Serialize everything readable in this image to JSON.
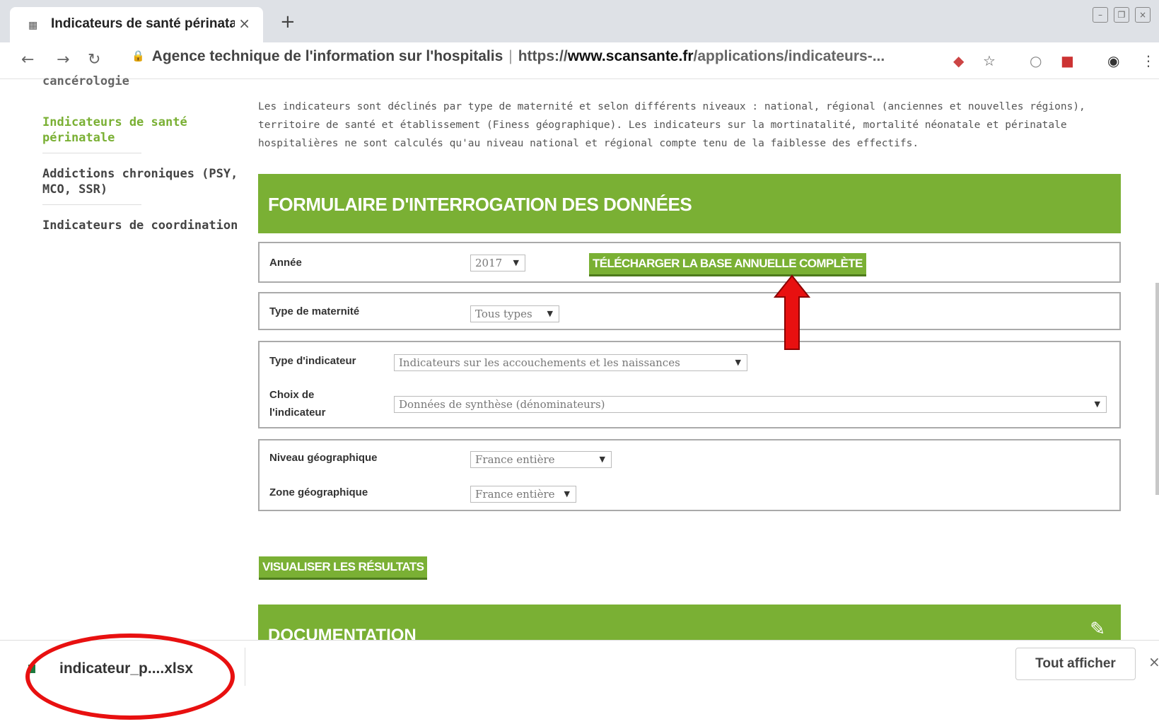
{
  "browser": {
    "tab_title": "Indicateurs de santé périnatale",
    "tab_close": "×",
    "new_tab": "+",
    "site_name": "Agence technique de l'information sur l'hospitalis",
    "url_scheme": "https://",
    "url_host": "www.scansante.fr",
    "url_path": "/applications/indicateurs-..."
  },
  "sidebar": {
    "items": [
      {
        "label": "cancérologie"
      },
      {
        "label": "Indicateurs de santé périnatale"
      },
      {
        "label": "Addictions chroniques (PSY, MCO, SSR)"
      },
      {
        "label": "Indicateurs de coordination"
      }
    ]
  },
  "intro": "Les indicateurs sont déclinés par type de maternité et selon différents niveaux : national, régional (anciennes et nouvelles régions), territoire de santé et établissement (Finess géographique). Les indicateurs sur la mortinatalité, mortalité néonatale et périnatale hospitalières ne sont calculés qu'au niveau national et régional compte tenu de la faiblesse des effectifs.",
  "form": {
    "title": "FORMULAIRE D'INTERROGATION DES DONNÉES",
    "annee_label": "Année",
    "annee_value": "2017",
    "download_label": "TÉLÉCHARGER LA BASE ANNUELLE COMPLÈTE",
    "maternite_label": "Type de maternité",
    "maternite_value": "Tous types",
    "type_ind_label": "Type d'indicateur",
    "type_ind_value": "Indicateurs sur les accouchements et les naissances",
    "choix_label_1": "Choix de",
    "choix_label_2": "l'indicateur",
    "choix_value": "Données de synthèse (dénominateurs)",
    "niveau_label": "Niveau géographique",
    "niveau_value": "France entière",
    "zone_label": "Zone géographique",
    "zone_value": "France entière",
    "submit_label": "VISUALISER LES RÉSULTATS"
  },
  "documentation_title": "DOCUMENTATION",
  "download_bar": {
    "file_name": "indicateur_p....xlsx",
    "show_all": "Tout afficher",
    "close": "×"
  },
  "colors": {
    "accent_green": "#7ab034",
    "annotation_red": "#e81010"
  }
}
